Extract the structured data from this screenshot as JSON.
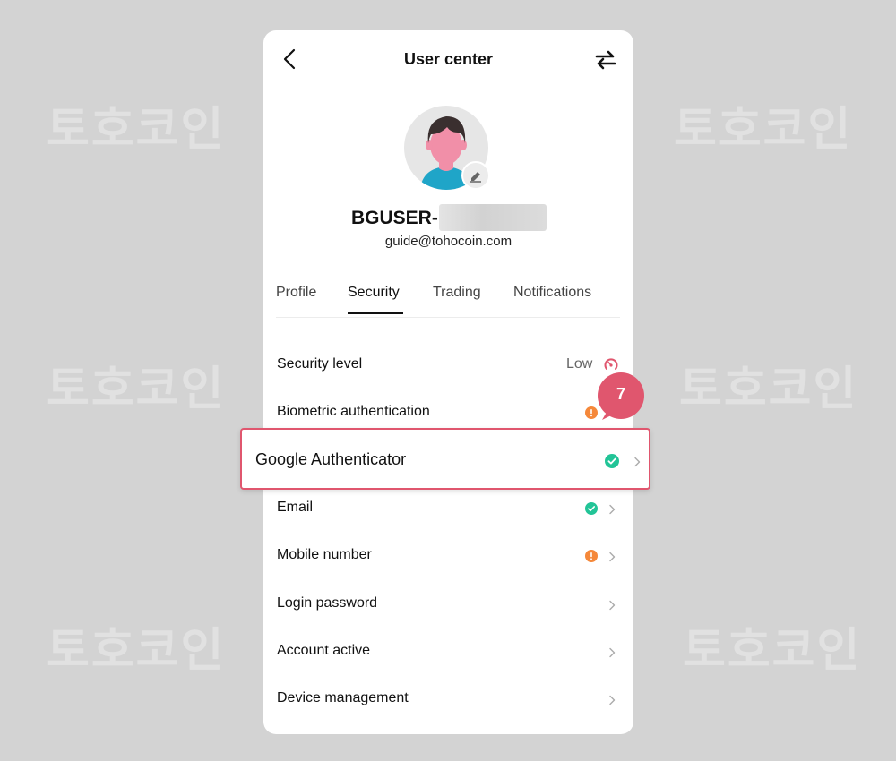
{
  "watermark": {
    "text": "토호코인"
  },
  "header": {
    "title": "User center",
    "back_icon": "chevron-left-icon",
    "switch_icon": "swap-arrows-icon"
  },
  "profile": {
    "username": "BGUSER-",
    "email": "guide@tohocoin.com"
  },
  "tabs": [
    {
      "label": "Profile",
      "active": false
    },
    {
      "label": "Security",
      "active": true
    },
    {
      "label": "Trading",
      "active": false
    },
    {
      "label": "Notifications",
      "active": false
    }
  ],
  "security": {
    "level_label": "Security level",
    "level_value": "Low",
    "items": [
      {
        "label": "Biometric authentication",
        "status": "warning"
      },
      {
        "label": "Google Authenticator",
        "status": "verified"
      },
      {
        "label": "Email",
        "status": "verified"
      },
      {
        "label": "Mobile number",
        "status": "warning"
      },
      {
        "label": "Login password",
        "status": "none"
      },
      {
        "label": "Account active",
        "status": "none"
      },
      {
        "label": "Device management",
        "status": "none"
      }
    ]
  },
  "callout": {
    "step": "7"
  },
  "colors": {
    "verified": "#22c497",
    "warning": "#f5883a",
    "highlight": "#e0566e",
    "level_low": "#e0566e"
  }
}
